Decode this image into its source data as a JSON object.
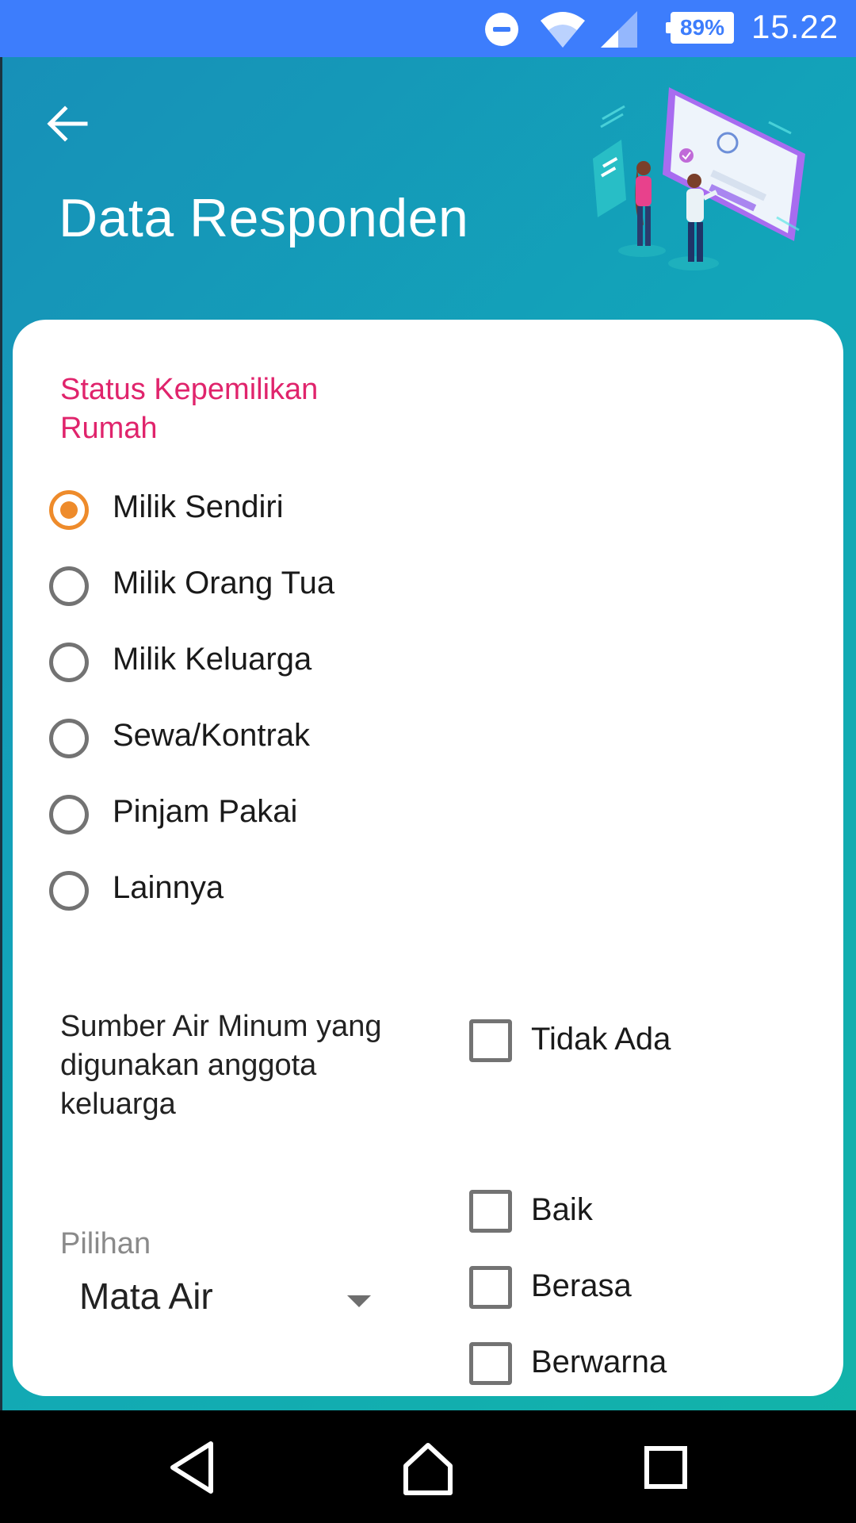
{
  "status_bar": {
    "time": "15.22",
    "battery": "89%",
    "icons": [
      "do-not-disturb-icon",
      "wifi-icon",
      "signal-icon",
      "battery-icon"
    ]
  },
  "header": {
    "title": "Data Responden",
    "back_icon": "back-arrow-icon",
    "illustration": "people-with-tablet-illustration"
  },
  "ownership": {
    "label": "Status Kepemilikan Rumah",
    "options": [
      {
        "label": "Milik Sendiri",
        "selected": true
      },
      {
        "label": "Milik Orang Tua",
        "selected": false
      },
      {
        "label": "Milik Keluarga",
        "selected": false
      },
      {
        "label": "Sewa/Kontrak",
        "selected": false
      },
      {
        "label": "Pinjam Pakai",
        "selected": false
      },
      {
        "label": "Lainnya",
        "selected": false
      }
    ]
  },
  "water": {
    "label": "Sumber Air Minum yang digunakan anggota keluarga",
    "dropdown_hint": "Pilihan",
    "dropdown_value": "Mata Air",
    "checkboxes": [
      {
        "label": "Tidak Ada",
        "checked": false
      },
      {
        "label": "Baik",
        "checked": false
      },
      {
        "label": "Berasa",
        "checked": false
      },
      {
        "label": "Berwarna",
        "checked": false
      }
    ]
  },
  "nav_bar": {
    "buttons": [
      "back-nav-icon",
      "home-nav-icon",
      "recents-nav-icon"
    ]
  },
  "colors": {
    "status_bar": "#3d7dfc",
    "header_gradient_start": "#1790b8",
    "header_gradient_end": "#12b3a9",
    "section_label": "#e0246c",
    "radio_selected": "#ee8b2b",
    "control_border": "#737373"
  }
}
